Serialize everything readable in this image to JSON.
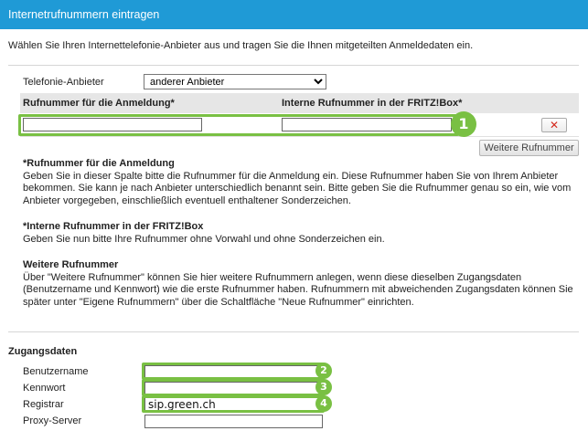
{
  "window": {
    "title": "Internetrufnummern eintragen"
  },
  "intro": "Wählen Sie Ihren Internettelefonie-Anbieter aus und tragen Sie die Ihnen mitgeteilten Anmeldedaten ein.",
  "provider": {
    "label": "Telefonie-Anbieter",
    "selected": "anderer Anbieter"
  },
  "numbers_table": {
    "col1_header": "Rufnummer für die Anmeldung*",
    "col2_header": "Interne Rufnummer in der FRITZ!Box*",
    "row": {
      "registration_number": "",
      "internal_number": ""
    },
    "delete_symbol": "✕"
  },
  "more_numbers_button": "Weitere Rufnummer",
  "help": {
    "reg_number_title": "*Rufnummer für die Anmeldung",
    "reg_number_text": "Geben Sie in dieser Spalte bitte die Rufnummer für die Anmeldung ein. Diese Rufnummer haben Sie von Ihrem Anbieter bekommen. Sie kann je nach Anbieter unterschiedlich benannt sein. Bitte geben Sie die Rufnummer genau so ein, wie vom Anbieter vorgegeben, einschließlich eventuell enthaltener Sonderzeichen.",
    "internal_number_title": "*Interne Rufnummer in der FRITZ!Box",
    "internal_number_text": "Geben Sie nun bitte Ihre Rufnummer ohne Vorwahl und ohne Sonderzeichen ein.",
    "more_numbers_title": "Weitere Rufnummer",
    "more_numbers_text": "Über \"Weitere Rufnummer\" können Sie hier weitere Rufnummern anlegen, wenn diese dieselben Zugangsdaten (Benutzername und Kennwort) wie die erste Rufnummer haben. Rufnummern mit abweichenden Zugangsdaten können Sie später unter \"Eigene Rufnummern\" über die Schaltfläche \"Neue Rufnummer\" einrichten."
  },
  "access": {
    "section_title": "Zugangsdaten",
    "username_label": "Benutzername",
    "username_value": "",
    "password_label": "Kennwort",
    "password_value": "",
    "registrar_label": "Registrar",
    "registrar_value": "sip.green.ch",
    "proxy_label": "Proxy-Server",
    "proxy_value": ""
  },
  "markers": [
    "1",
    "2",
    "3",
    "4"
  ],
  "colors": {
    "titlebar": "#1f9ad6",
    "highlight": "#79c043",
    "delete": "#d42a1e",
    "table_header": "#e6e6e6"
  }
}
